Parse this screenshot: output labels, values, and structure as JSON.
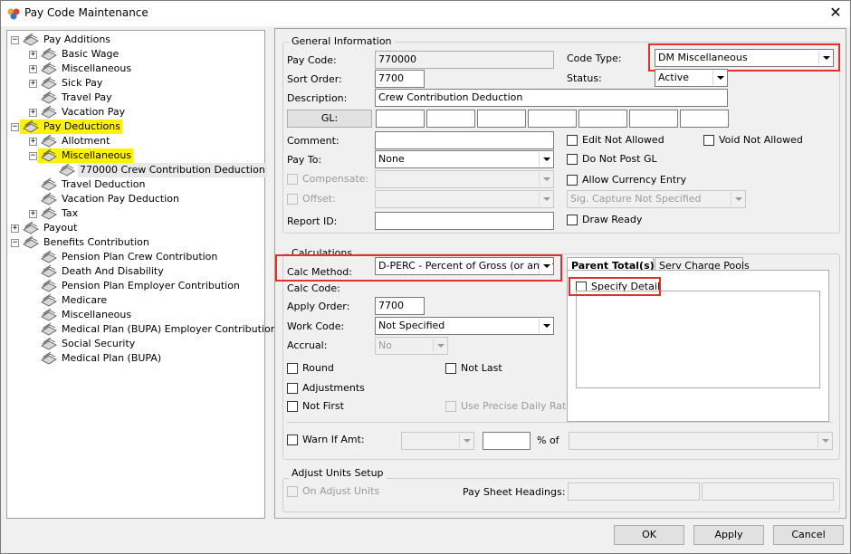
{
  "window": {
    "title": "Pay Code Maintenance",
    "close": "✕"
  },
  "tree": [
    {
      "label": "Pay Additions",
      "level": 0,
      "exp": "−",
      "hl": false
    },
    {
      "label": "Basic Wage",
      "level": 1,
      "exp": "+",
      "hl": false
    },
    {
      "label": "Miscellaneous",
      "level": 1,
      "exp": "+",
      "hl": false
    },
    {
      "label": "Sick Pay",
      "level": 1,
      "exp": "+",
      "hl": false
    },
    {
      "label": "Travel Pay",
      "level": 1,
      "exp": "",
      "hl": false
    },
    {
      "label": "Vacation Pay",
      "level": 1,
      "exp": "+",
      "hl": false
    },
    {
      "label": "Pay Deductions",
      "level": 0,
      "exp": "−",
      "hl": true
    },
    {
      "label": "Allotment",
      "level": 1,
      "exp": "+",
      "hl": false
    },
    {
      "label": "Miscellaneous",
      "level": 1,
      "exp": "−",
      "hl": true
    },
    {
      "label": "770000 Crew Contribution Deduction",
      "level": 2,
      "exp": "",
      "hl": false,
      "sel": true
    },
    {
      "label": "Travel Deduction",
      "level": 1,
      "exp": "",
      "hl": false
    },
    {
      "label": "Vacation Pay Deduction",
      "level": 1,
      "exp": "",
      "hl": false
    },
    {
      "label": "Tax",
      "level": 1,
      "exp": "+",
      "hl": false
    },
    {
      "label": "Payout",
      "level": 0,
      "exp": "+",
      "hl": false
    },
    {
      "label": "Benefits Contribution",
      "level": 0,
      "exp": "−",
      "hl": false
    },
    {
      "label": "Pension Plan Crew Contribution",
      "level": 1,
      "exp": "",
      "hl": false
    },
    {
      "label": "Death And Disability",
      "level": 1,
      "exp": "",
      "hl": false
    },
    {
      "label": "Pension Plan Employer Contribution",
      "level": 1,
      "exp": "",
      "hl": false
    },
    {
      "label": "Medicare",
      "level": 1,
      "exp": "",
      "hl": false
    },
    {
      "label": "Miscellaneous",
      "level": 1,
      "exp": "",
      "hl": false
    },
    {
      "label": "Medical Plan (BUPA) Employer Contribution",
      "level": 1,
      "exp": "",
      "hl": false
    },
    {
      "label": "Social Security",
      "level": 1,
      "exp": "",
      "hl": false
    },
    {
      "label": "Medical Plan (BUPA)",
      "level": 1,
      "exp": "",
      "hl": false
    }
  ],
  "general": {
    "title": "General Information",
    "pay_code_label": "Pay Code:",
    "pay_code": "770000",
    "code_type_label": "Code Type:",
    "code_type": "DM Miscellaneous",
    "sort_order_label": "Sort Order:",
    "sort_order": "7700",
    "status_label": "Status:",
    "status": "Active",
    "description_label": "Description:",
    "description": "Crew Contribution Deduction",
    "gl_button": "GL:",
    "comment_label": "Comment:",
    "edit_not_allowed": "Edit Not Allowed",
    "void_not_allowed": "Void Not Allowed",
    "pay_to_label": "Pay To:",
    "pay_to": "None",
    "do_not_post_gl": "Do Not Post GL",
    "compensate_label": "Compensate:",
    "allow_currency_entry": "Allow Currency Entry",
    "offset_label": "Offset:",
    "sig_capture": "Sig. Capture Not Specified",
    "report_id_label": "Report ID:",
    "draw_ready": "Draw Ready"
  },
  "calc": {
    "title": "Calculations",
    "calc_method_label": "Calc Method:",
    "calc_method": "D-PERC - Percent of Gross (or anoth",
    "calc_code_label": "Calc Code:",
    "apply_order_label": "Apply Order:",
    "apply_order": "7700",
    "work_code_label": "Work Code:",
    "work_code": "Not Specified",
    "accrual_label": "Accrual:",
    "accrual": "No",
    "round": "Round",
    "not_last": "Not Last",
    "adjustments": "Adjustments",
    "not_first": "Not First",
    "use_precise_daily_rate": "Use Precise Daily Rate",
    "warn_if_amt": "Warn If Amt:",
    "pct_of": "% of",
    "tabs": [
      "Parent Total(s)",
      "Serv Charge Pools"
    ],
    "specify_detail": "Specify Detail"
  },
  "adjust": {
    "title": "Adjust Units Setup",
    "on_adjust_units": "On Adjust Units",
    "pay_sheet_headings_label": "Pay Sheet Headings:"
  },
  "buttons": {
    "ok": "OK",
    "apply": "Apply",
    "cancel": "Cancel"
  }
}
